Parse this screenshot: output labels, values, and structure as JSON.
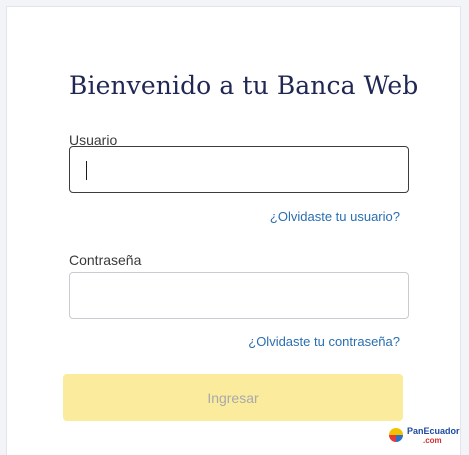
{
  "login": {
    "title": "Bienvenido a tu Banca Web",
    "username_label": "Usuario",
    "username_value": "",
    "forgot_username": "¿Olvidaste tu usuario?",
    "password_label": "Contraseña",
    "password_value": "",
    "forgot_password": "¿Olvidaste tu contraseña?",
    "submit_label": "Ingresar"
  },
  "watermark": {
    "name": "PanEcuador",
    "tld": ".com"
  },
  "colors": {
    "title": "#1f2752",
    "link": "#2a6eb0",
    "button_bg": "#fbeb9c",
    "button_text": "#a8a9ad"
  }
}
